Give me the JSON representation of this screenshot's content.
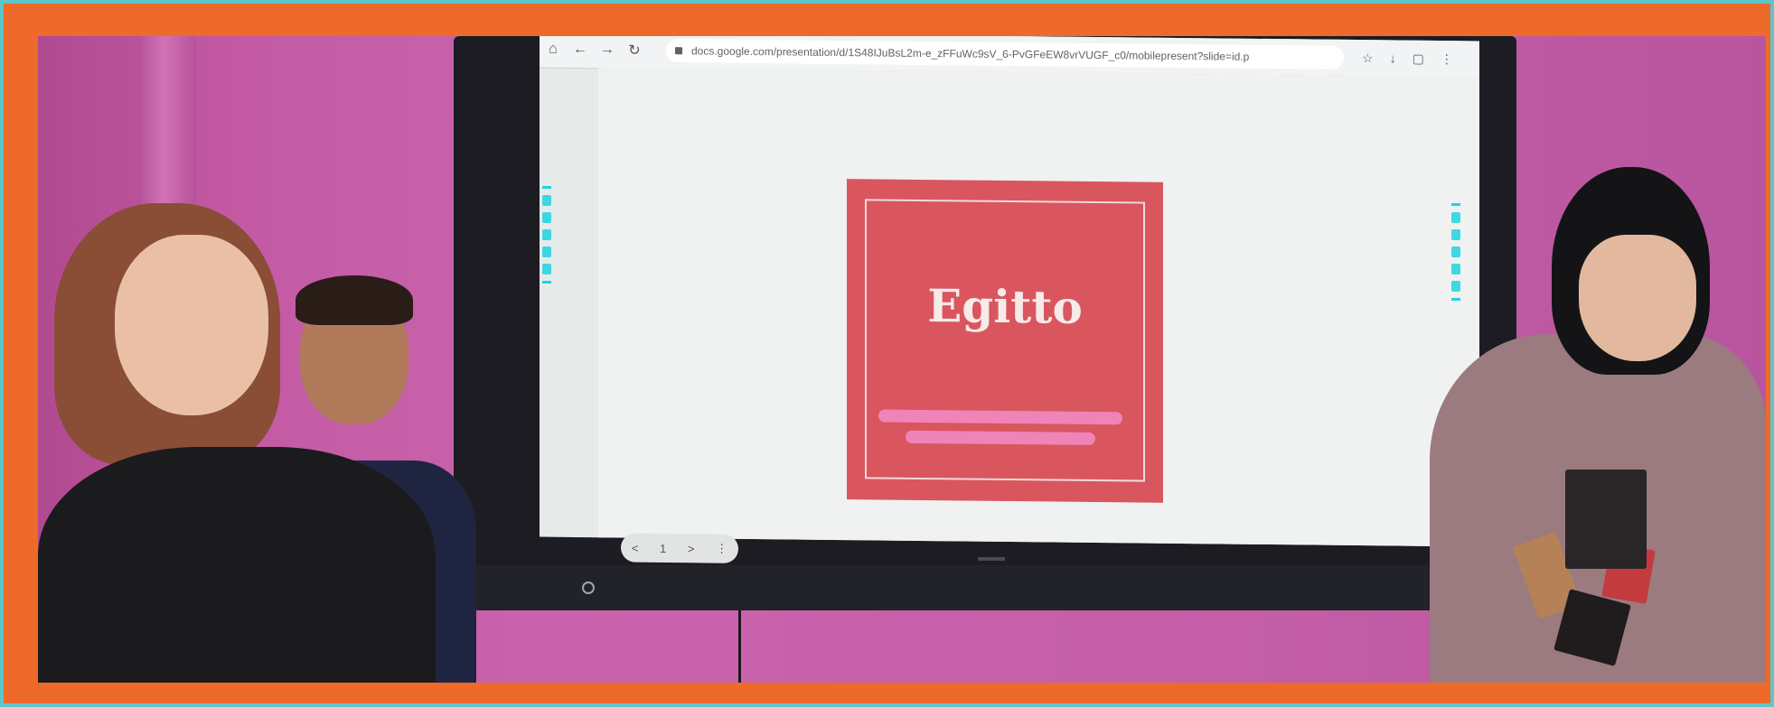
{
  "browser": {
    "url": "docs.google.com/presentation/d/1S48IJuBsL2m-e_zFFuWc9sV_6-PvGFeEW8vrVUGF_c0/mobilepresent?slide=id.p",
    "back_icon": "arrow-left-icon",
    "forward_icon": "arrow-right-icon",
    "reload_icon": "reload-icon",
    "home_icon": "home-icon"
  },
  "slide": {
    "title": "Egitto",
    "page_number": "1",
    "prev_label": "<",
    "next_label": ">",
    "menu_label": "⋮"
  },
  "colors": {
    "border_orange": "#ee6a2a",
    "border_teal": "#5ec6c9",
    "wall_pink": "#c45aa4",
    "slide_red": "#d9565f"
  }
}
